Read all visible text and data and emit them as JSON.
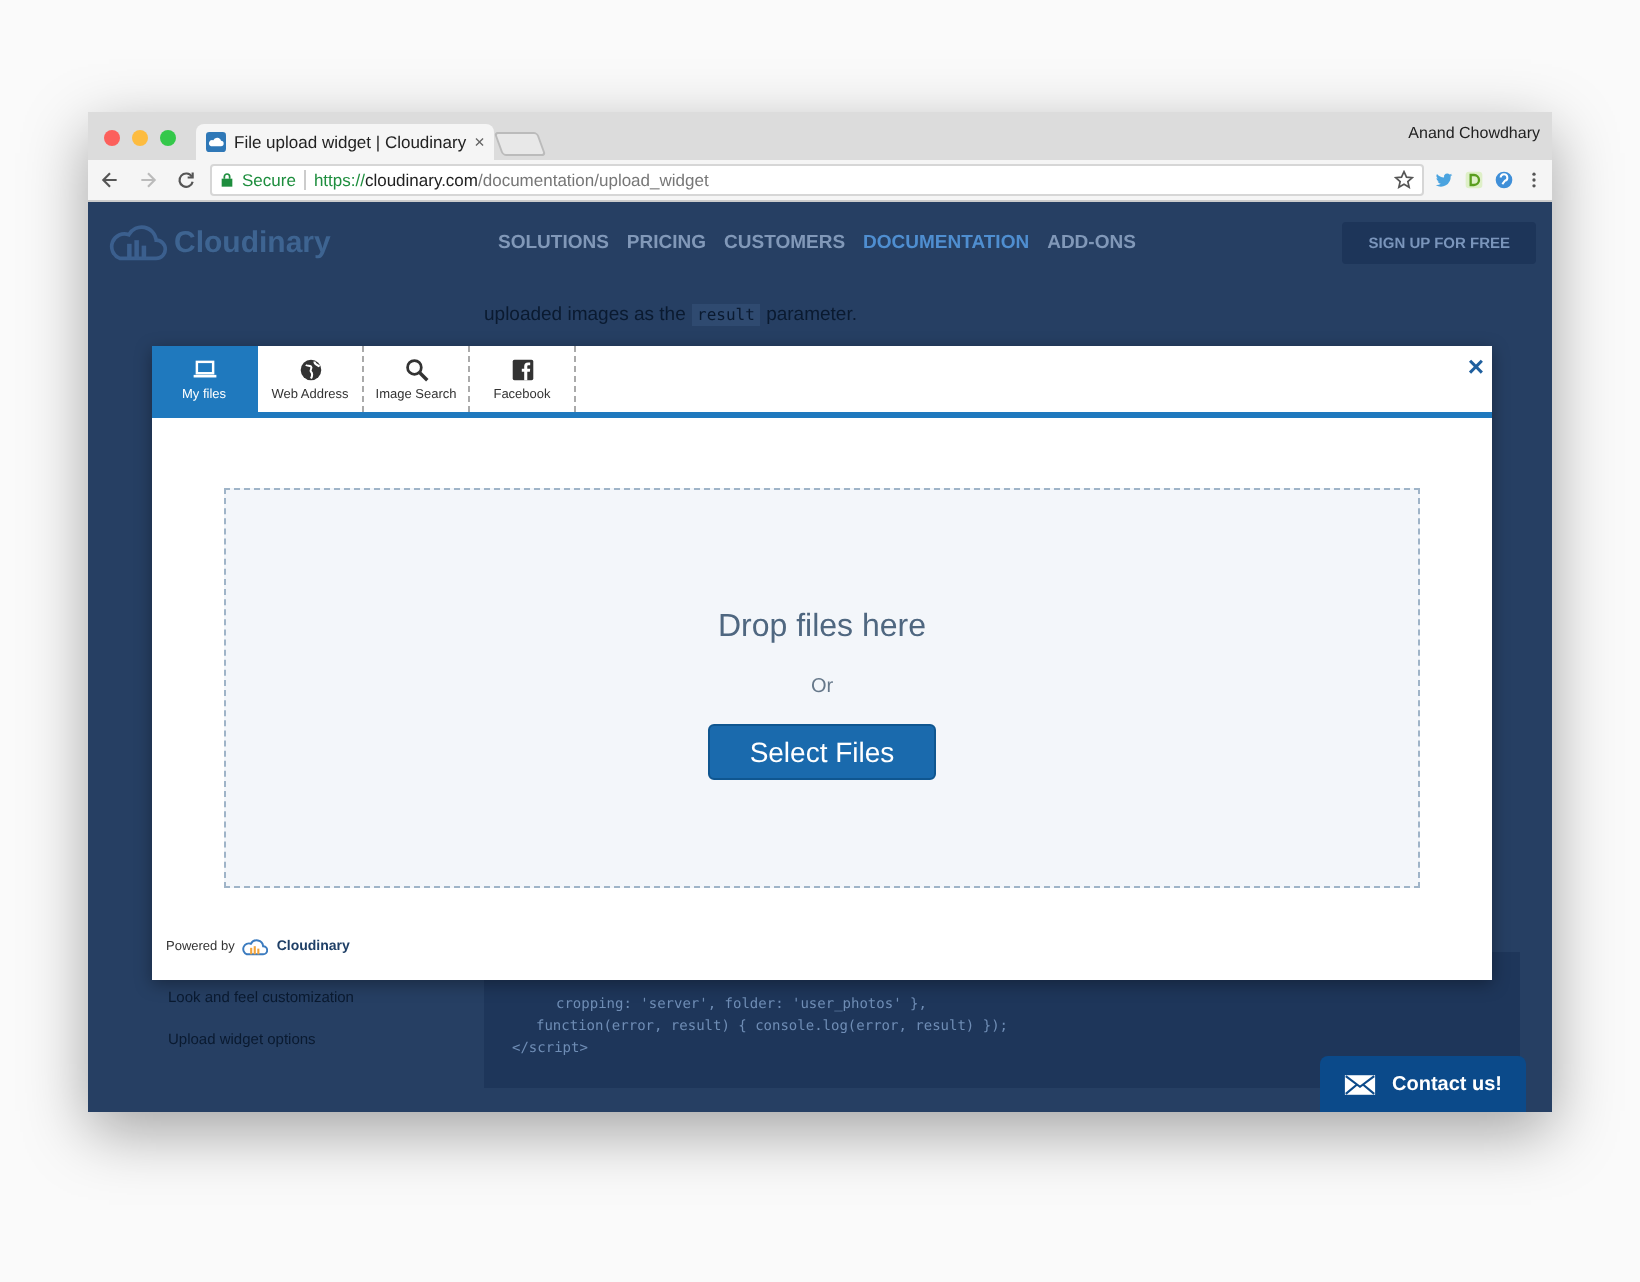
{
  "browser": {
    "tab_title": "File upload widget | Cloudinary",
    "tab_close": "×",
    "user": "Anand Chowdhary",
    "secure_label": "Secure",
    "url_scheme": "https://",
    "url_host": "cloudinary.com",
    "url_path": "/documentation/upload_widget"
  },
  "site": {
    "logo": "Cloudinary",
    "nav": [
      {
        "label": "SOLUTIONS",
        "selected": false
      },
      {
        "label": "PRICING",
        "selected": false
      },
      {
        "label": "CUSTOMERS",
        "selected": false
      },
      {
        "label": "DOCUMENTATION",
        "selected": true
      },
      {
        "label": "ADD-ONS",
        "selected": false
      }
    ],
    "signup": "SIGN UP FOR FREE",
    "intro_before": "uploaded images as the",
    "intro_code": "result",
    "intro_after": "parameter.",
    "sidebar_items": [
      "Look and feel customization",
      "Upload widget options"
    ],
    "code_lines": [
      "cropping: 'server', folder: 'user_photos' },",
      "function(error, result) { console.log(error, result) });",
      "</script>"
    ]
  },
  "widget": {
    "tabs": [
      {
        "label": "My files",
        "selected": true
      },
      {
        "label": "Web Address",
        "selected": false
      },
      {
        "label": "Image Search",
        "selected": false
      },
      {
        "label": "Facebook",
        "selected": false
      }
    ],
    "close": "×",
    "drop_text": "Drop files here",
    "or_text": "Or",
    "select_button": "Select Files",
    "powered_by": "Powered by",
    "brand": "Cloudinary"
  },
  "contact_button": "Contact us!"
}
